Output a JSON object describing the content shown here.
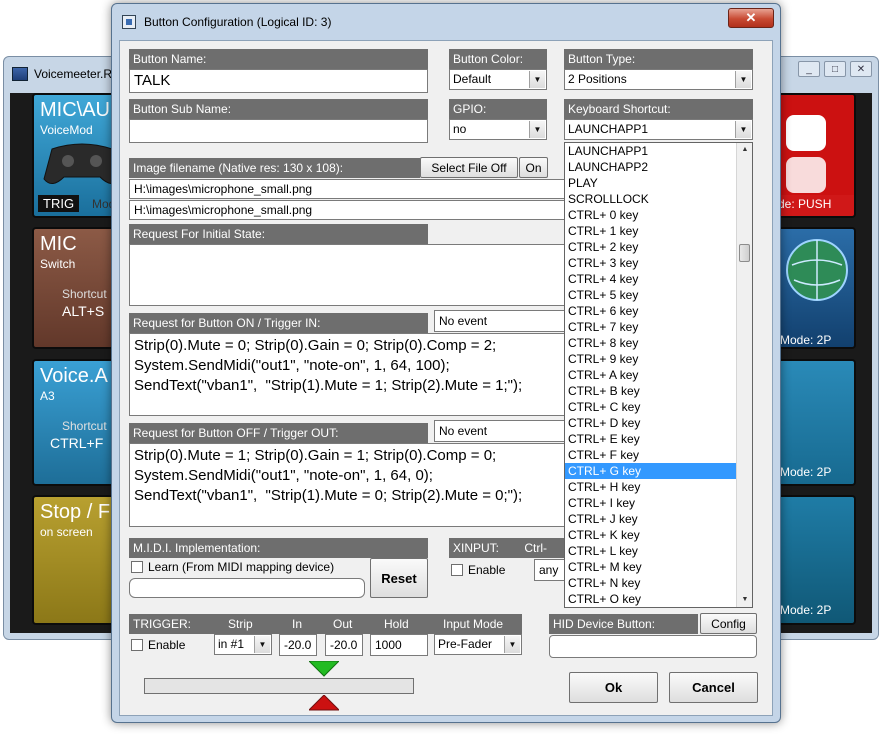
{
  "background_app": {
    "title": "Voicemeeter.Re",
    "window_controls": [
      "_",
      "□",
      "✕"
    ],
    "tiles": [
      {
        "title": "MIC\\AU",
        "subtitle": "VoiceMod",
        "badge": "TRIG",
        "extra": "Mod"
      },
      {
        "title": "MIC",
        "subtitle": "Switch",
        "shortcut_label": "Shortcut",
        "shortcut": "ALT+S"
      },
      {
        "title": "Voice.A",
        "subtitle": "A3",
        "shortcut_label": "Shortcut",
        "shortcut": "CTRL+F"
      },
      {
        "title": "Stop / F",
        "subtitle": "on screen"
      },
      {
        "mode": "de: PUSH"
      },
      {
        "mode": "Mode: 2P"
      },
      {
        "mode": "Mode: 2P"
      },
      {
        "mode": "Mode: 2P"
      }
    ]
  },
  "dialog": {
    "title": "Button Configuration (Logical ID: 3)",
    "close": "✕",
    "button_name": {
      "label": "Button Name:",
      "value": "TALK"
    },
    "button_color": {
      "label": "Button Color:",
      "value": "Default"
    },
    "button_type": {
      "label": "Button Type:",
      "value": "2 Positions"
    },
    "button_sub_name": {
      "label": "Button Sub Name:",
      "value": ""
    },
    "gpio": {
      "label": "GPIO:",
      "value": "no"
    },
    "keyboard_shortcut": {
      "label": "Keyboard Shortcut:",
      "value": "LAUNCHAPP1",
      "options": [
        "LAUNCHAPP1",
        "LAUNCHAPP2",
        "PLAY",
        "SCROLLLOCK",
        "CTRL+ 0 key",
        "CTRL+ 1 key",
        "CTRL+ 2 key",
        "CTRL+ 3 key",
        "CTRL+ 4 key",
        "CTRL+ 5 key",
        "CTRL+ 6 key",
        "CTRL+ 7 key",
        "CTRL+ 8 key",
        "CTRL+ 9 key",
        "CTRL+ A key",
        "CTRL+ B key",
        "CTRL+ C key",
        "CTRL+ D key",
        "CTRL+ E key",
        "CTRL+ F key",
        "CTRL+ G key",
        "CTRL+ H key",
        "CTRL+ I key",
        "CTRL+ J key",
        "CTRL+ K key",
        "CTRL+ L key",
        "CTRL+ M key",
        "CTRL+ N key",
        "CTRL+ O key"
      ],
      "selected_index": 20
    },
    "image": {
      "label": "Image filename (Native res: 130 x 108):",
      "select_file_off": "Select File Off",
      "on": "On",
      "file1": "H:\\images\\microphone_small.png",
      "file2": "H:\\images\\microphone_small.png"
    },
    "initial_state": {
      "label": "Request For Initial State:",
      "value": ""
    },
    "on_trigger": {
      "label": "Request for Button ON / Trigger IN:",
      "event": "No event",
      "lines": [
        "Strip(0).Mute = 0; Strip(0).Gain = 0; Strip(0).Comp = 2;",
        "System.SendMidi(\"out1\", \"note-on\", 1, 64, 100);",
        "SendText(\"vban1\",  \"Strip(1).Mute = 1; Strip(2).Mute = 1;\");"
      ]
    },
    "off_trigger": {
      "label": "Request for Button OFF / Trigger OUT:",
      "event": "No event",
      "lines": [
        "Strip(0).Mute = 1; Strip(0).Gain = 1; Strip(0).Comp = 0;",
        "System.SendMidi(\"out1\", \"note-on\", 1, 64, 0);",
        "SendText(\"vban1\",  \"Strip(1).Mute = 0; Strip(2).Mute = 0;\");"
      ]
    },
    "midi": {
      "label": "M.I.D.I. Implementation:",
      "learn": "Learn (From MIDI mapping device)",
      "reset": "Reset",
      "value": ""
    },
    "xinput": {
      "label": "XINPUT:",
      "ctrl": "Ctrl-",
      "enable": "Enable",
      "value": "any"
    },
    "trigger": {
      "label": "TRIGGER:",
      "col_strip": "Strip",
      "col_in": "In",
      "col_out": "Out",
      "col_hold": "Hold",
      "col_input_mode": "Input Mode",
      "enable": "Enable",
      "strip": "in #1",
      "in": "-20.0",
      "out": "-20.0",
      "hold": "1000",
      "input_mode": "Pre-Fader"
    },
    "hid": {
      "label": "HID Device Button:",
      "config": "Config",
      "value": ""
    },
    "ok": "Ok",
    "cancel": "Cancel",
    "colors": {
      "header": "#6e6e6e",
      "selection": "#3399ff",
      "trigger_on": "#22bb22",
      "trigger_off": "#cc1111"
    }
  }
}
